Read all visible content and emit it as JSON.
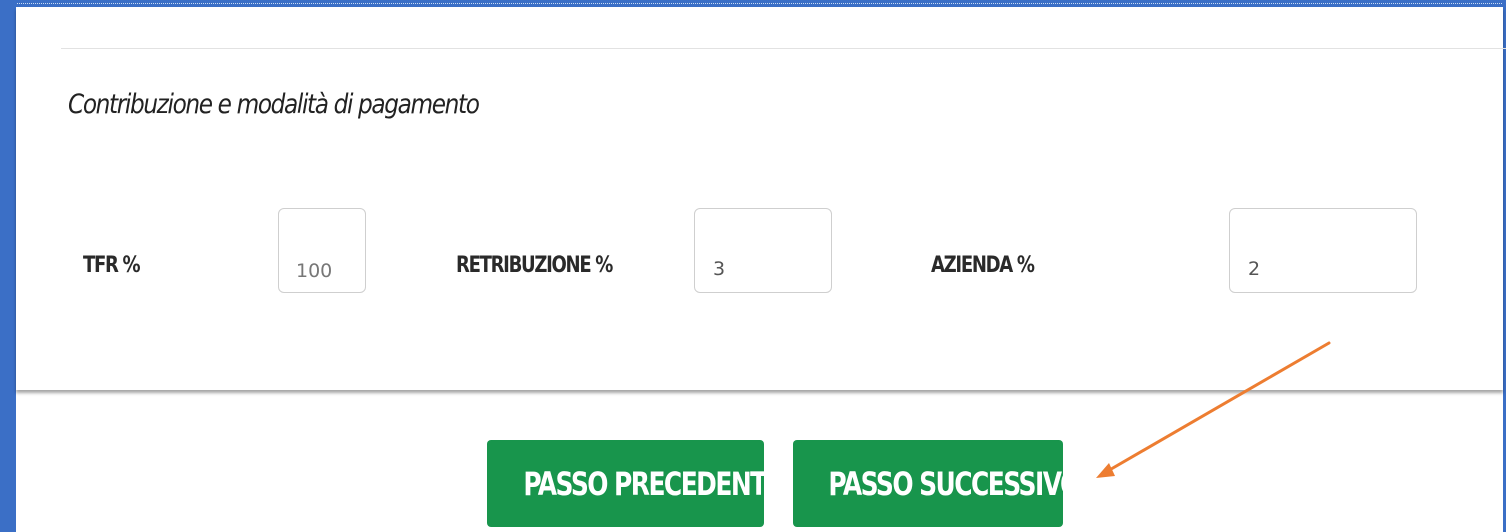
{
  "section": {
    "title": "Contribuzione e modalità di pagamento"
  },
  "fields": {
    "tfr": {
      "label": "TFR %",
      "value": "100"
    },
    "retribuzione": {
      "label": "RETRIBUZIONE %",
      "value": "3"
    },
    "azienda": {
      "label": "AZIENDA %",
      "value": "2"
    }
  },
  "buttons": {
    "previous_label": "PASSO PRECEDENTE",
    "next_label": "PASSO SUCCESSIVO"
  },
  "colors": {
    "frame": "#3b6fc6",
    "button": "#18954c",
    "annotation_arrow": "#ed7d31"
  },
  "icons": {
    "annotation": "arrow-pointer-icon"
  }
}
